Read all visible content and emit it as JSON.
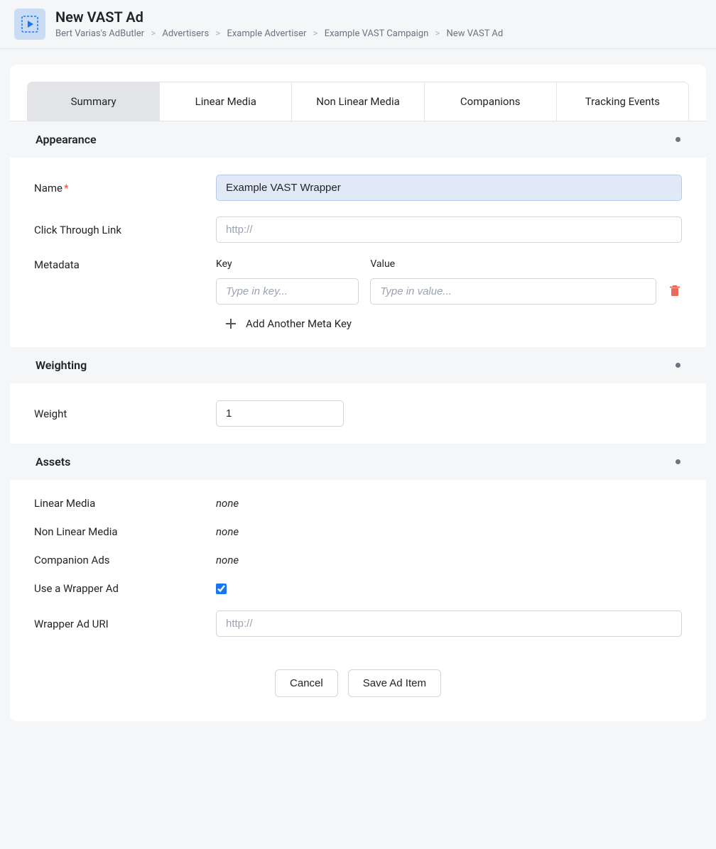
{
  "header": {
    "title": "New VAST Ad",
    "breadcrumb": [
      "Bert Varias's AdButler",
      "Advertisers",
      "Example Advertiser",
      "Example VAST Campaign",
      "New VAST Ad"
    ]
  },
  "tabs": {
    "summary": "Summary",
    "linear": "Linear Media",
    "nonlinear": "Non Linear Media",
    "companions": "Companions",
    "tracking": "Tracking Events"
  },
  "appearance": {
    "title": "Appearance",
    "name_label": "Name",
    "name_value": "Example VAST Wrapper",
    "click_label": "Click Through Link",
    "click_placeholder": "http://",
    "metadata_label": "Metadata",
    "key_label": "Key",
    "value_label": "Value",
    "key_placeholder": "Type in key...",
    "value_placeholder": "Type in value...",
    "add_meta_label": "Add Another Meta Key"
  },
  "weighting": {
    "title": "Weighting",
    "weight_label": "Weight",
    "weight_value": "1"
  },
  "assets": {
    "title": "Assets",
    "linear_label": "Linear Media",
    "linear_value": "none",
    "nonlinear_label": "Non Linear Media",
    "nonlinear_value": "none",
    "companion_label": "Companion Ads",
    "companion_value": "none",
    "wrapper_label": "Use a Wrapper Ad",
    "wrapper_checked": true,
    "wrapper_uri_label": "Wrapper Ad URI",
    "wrapper_uri_placeholder": "http://"
  },
  "footer": {
    "cancel": "Cancel",
    "save": "Save Ad Item"
  }
}
